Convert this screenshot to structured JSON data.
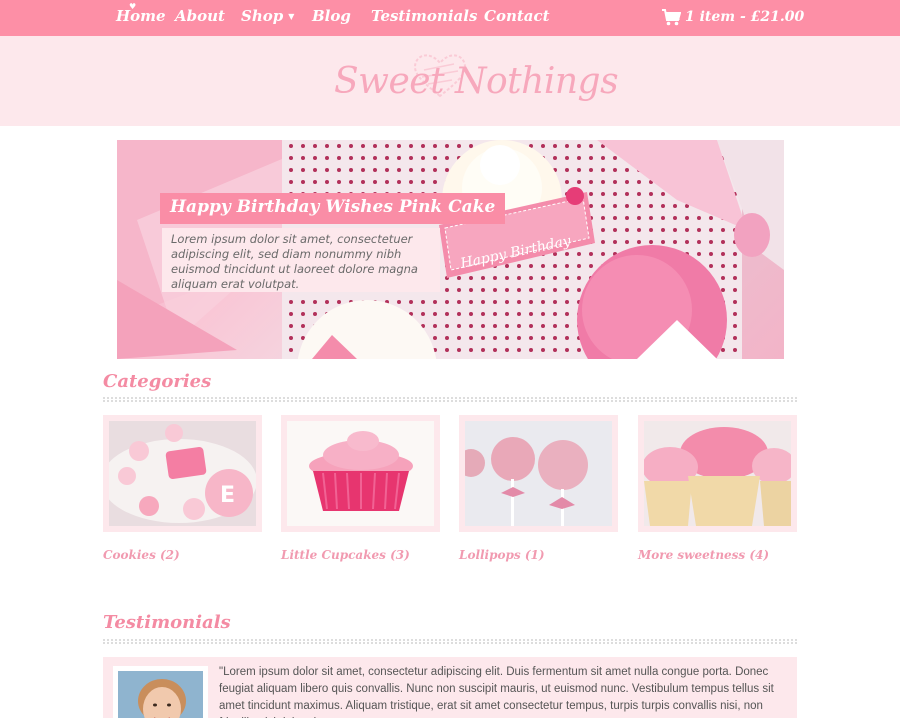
{
  "nav": {
    "items": [
      {
        "label": "Home"
      },
      {
        "label": "About"
      },
      {
        "label": "Shop"
      },
      {
        "label": "Blog"
      },
      {
        "label": "Testimonials"
      },
      {
        "label": "Contact"
      }
    ],
    "cart_label": "1 item - £21.00",
    "icons": {
      "cart": "cart-icon",
      "shop_dropdown": "caret-down-icon",
      "home": "heart-icon"
    }
  },
  "header": {
    "logo": "Sweet Nothings"
  },
  "hero": {
    "title": "Happy Birthday Wishes Pink Cake",
    "text": "Lorem ipsum dolor sit amet, consectetuer adipiscing elit, sed diam nonummy nibh euismod tincidunt ut laoreet dolore magna aliquam erat volutpat.",
    "tag_text": "Happy Birthday"
  },
  "categories": {
    "title": "Categories",
    "items": [
      {
        "label": "Cookies (2)"
      },
      {
        "label": "Little Cupcakes (3)"
      },
      {
        "label": "Lollipops (1)"
      },
      {
        "label": "More sweetness (4)"
      }
    ]
  },
  "testimonials": {
    "title": "Testimonials",
    "quote": "\"Lorem ipsum dolor sit amet, consectetur adipiscing elit. Duis fermentum sit amet nulla congue porta. Donec feugiat aliquam libero quis convallis. Nunc non suscipit mauris, ut euismod nunc. Vestibulum tempus tellus sit amet tincidunt maximus. Aliquam tristique, erat sit amet consectetur tempus, turpis turpis convallis nisi, non fringilla nisi dolor vitae"
  },
  "colors": {
    "nav": "#fd8fa6",
    "header_bg": "#fde8ec",
    "accent": "#f48ba3"
  }
}
